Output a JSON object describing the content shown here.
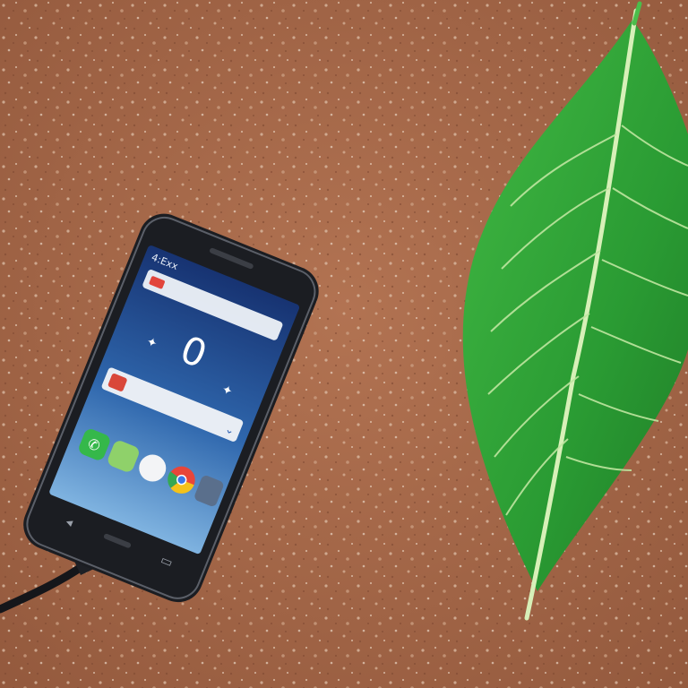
{
  "scene": {
    "background": "soil",
    "colors": {
      "soil": "#a8694a",
      "soil_dark": "#8d5238",
      "soil_light": "#d6b39a",
      "phone_body": "#1b1d22",
      "screen_top": "#1c3f86",
      "screen_bottom": "#6fa3d6",
      "leaf": "#2fa63a",
      "leaf_dark": "#1f7c27",
      "leaf_vein": "#d7f0b8",
      "cable": "#15161a"
    }
  },
  "phone": {
    "status_text": "4:Exx",
    "clock_text": "0",
    "dock_icons": [
      "phone-icon",
      "messages-icon",
      "camera-icon",
      "chrome-icon",
      "apps-icon"
    ]
  },
  "leaf": {
    "label": "green leaf"
  }
}
